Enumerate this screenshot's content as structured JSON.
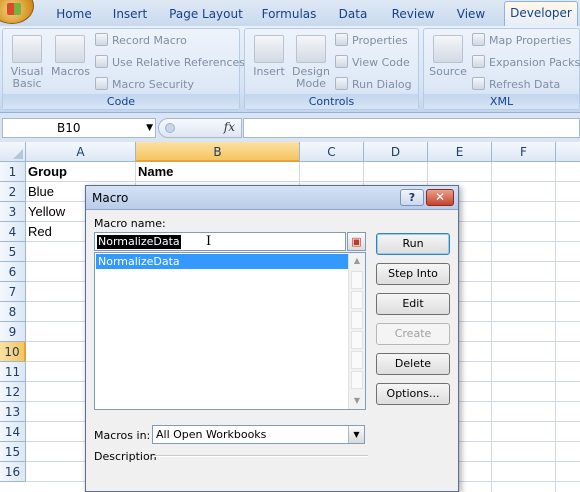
{
  "ribbon": {
    "tabs": [
      {
        "label": "Home"
      },
      {
        "label": "Insert"
      },
      {
        "label": "Page Layout"
      },
      {
        "label": "Formulas"
      },
      {
        "label": "Data"
      },
      {
        "label": "Review"
      },
      {
        "label": "View"
      },
      {
        "label": "Developer",
        "active": true
      }
    ],
    "code_group": {
      "label": "Code",
      "visual_basic": "Visual Basic",
      "macros": "Macros",
      "record_macro": "Record Macro",
      "use_relative": "Use Relative References",
      "macro_security": "Macro Security"
    },
    "controls_group": {
      "label": "Controls",
      "insert": "Insert",
      "design_mode": "Design Mode",
      "properties": "Properties",
      "view_code": "View Code",
      "run_dialog": "Run Dialog"
    },
    "xml_group": {
      "label": "XML",
      "source": "Source",
      "map_properties": "Map Properties",
      "expansion_packs": "Expansion Packs",
      "refresh_data": "Refresh Data"
    }
  },
  "formula_bar": {
    "name_box": "B10",
    "fx_label": "fx",
    "formula": ""
  },
  "sheet": {
    "columns": [
      "A",
      "B",
      "C",
      "D",
      "E",
      "F"
    ],
    "selected_column": "B",
    "rows": [
      "1",
      "2",
      "3",
      "4",
      "5",
      "6",
      "7",
      "8",
      "9",
      "10",
      "11",
      "12",
      "13",
      "14",
      "15",
      "16"
    ],
    "selected_row": "10",
    "cells": {
      "A1": "Group",
      "B1": "Name",
      "A2": "Blue",
      "A3": "Yellow",
      "A4": "Red"
    }
  },
  "dialog": {
    "title": "Macro",
    "help_glyph": "?",
    "close_glyph": "✕",
    "macro_name_label": "Macro name:",
    "macro_name_value": "NormalizeData",
    "macro_list": [
      "NormalizeData"
    ],
    "buttons": {
      "run": "Run",
      "step_into": "Step Into",
      "edit": "Edit",
      "create": "Create",
      "delete": "Delete",
      "options": "Options..."
    },
    "macros_in_label": "Macros in:",
    "macros_in_value": "All Open Workbooks",
    "description_label": "Description"
  },
  "colors": {
    "accent": "#15428b",
    "selection": "#3399ff",
    "header_highlight": "#f5c55f"
  }
}
